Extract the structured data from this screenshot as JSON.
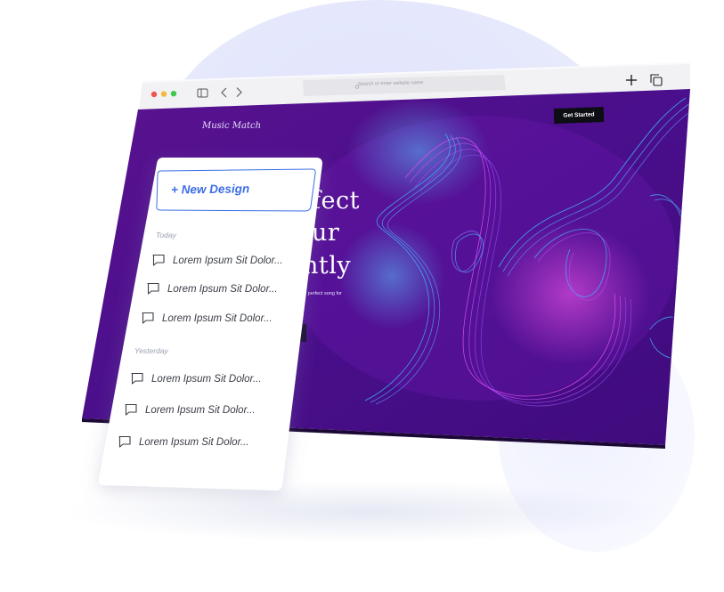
{
  "browser": {
    "search_placeholder": "Search or enter website name",
    "icons": [
      "close-dot",
      "minimize-dot",
      "maximize-dot",
      "sidebar-icon",
      "back-icon",
      "forward-icon",
      "search-icon",
      "plus-icon",
      "tabs-icon"
    ],
    "colors": {
      "close": "#f0544f",
      "minimize": "#f6b73c",
      "maximize": "#3fc94f"
    }
  },
  "site": {
    "title": "Music Match",
    "cta_label": "Get Started",
    "hero_lines": [
      "fect",
      "ur",
      "ntly"
    ],
    "hero_sub": "he perfect song for",
    "colors": {
      "background": "#4c0f92",
      "accent_blue": "#3fb8ff",
      "accent_pink": "#e04cf0"
    }
  },
  "panel": {
    "new_design_label": "+ New Design",
    "today_label": "Today",
    "yesterday_label": "Yesterday",
    "today_items": [
      "Lorem Ipsum Sit Dolor...",
      "Lorem Ipsum Sit Dolor...",
      "Lorem Ipsum Sit Dolor..."
    ],
    "yesterday_items": [
      "Lorem Ipsum Sit Dolor...",
      "Lorem Ipsum Sit Dolor...",
      "Lorem Ipsum Sit Dolor..."
    ],
    "colors": {
      "accent": "#3c6ee6",
      "text": "#3a3d46"
    }
  }
}
